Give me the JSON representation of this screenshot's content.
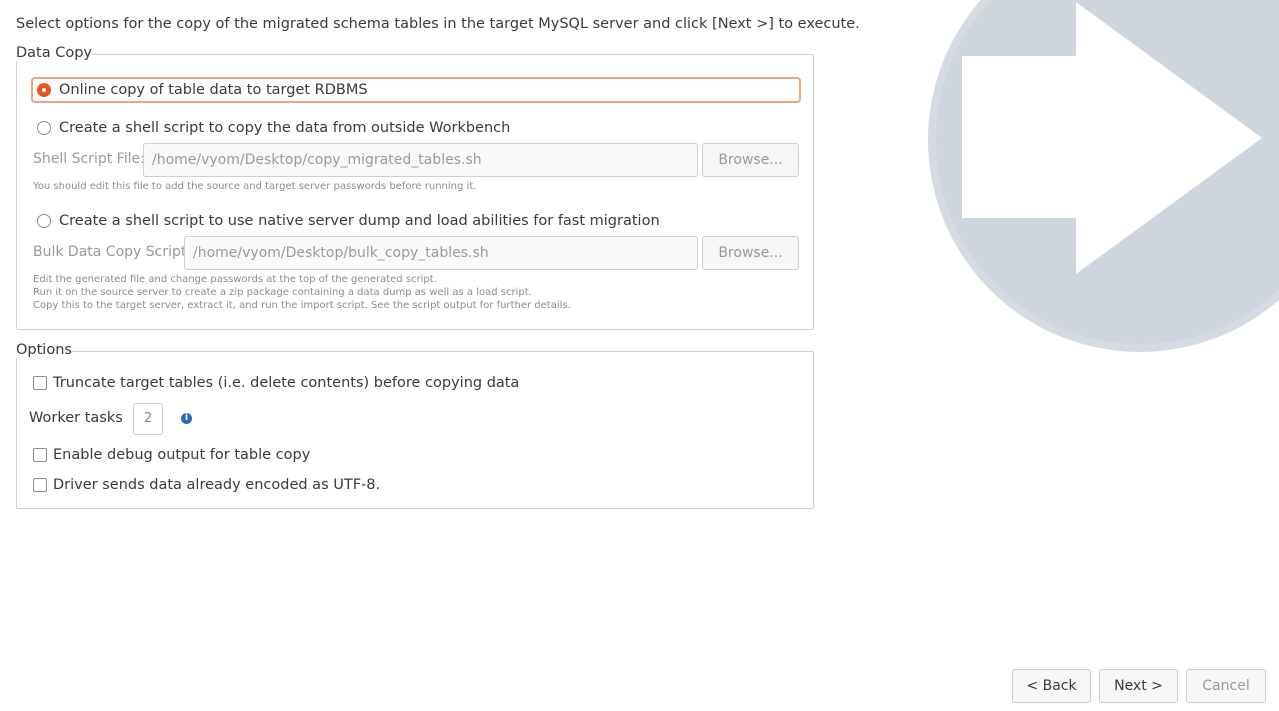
{
  "instruction": "Select options for the copy of the migrated schema tables in the target MySQL server and click [Next >] to execute.",
  "data_copy": {
    "title": "Data Copy",
    "online_copy": {
      "label": "Online copy of table data to target RDBMS",
      "checked": true
    },
    "shell_script": {
      "label": "Create a shell script to copy the data from outside Workbench",
      "checked": false,
      "field_label": "Shell Script File:",
      "field_value": "/home/vyom/Desktop/copy_migrated_tables.sh",
      "browse_label": "Browse...",
      "hint": "You should edit this file to add the source and target server passwords before running it."
    },
    "bulk_script": {
      "label": "Create a shell script to use native server dump and load abilities for fast migration",
      "checked": false,
      "field_label": "Bulk Data Copy Script:",
      "field_value": "/home/vyom/Desktop/bulk_copy_tables.sh",
      "browse_label": "Browse...",
      "hint_lines": [
        "Edit the generated file and change passwords at the top of the generated script.",
        "Run it on the source server to create a zip package containing a data dump as well as a load script.",
        "Copy this to the target server, extract it, and run the import script. See the script output for further details."
      ]
    }
  },
  "options": {
    "title": "Options",
    "truncate": {
      "label": "Truncate target tables (i.e. delete contents) before copying data",
      "checked": false
    },
    "worker_tasks": {
      "label": "Worker tasks",
      "value": "2",
      "icon": "info-icon"
    },
    "debug": {
      "label": "Enable debug output for table copy",
      "checked": false
    },
    "utf8": {
      "label": "Driver sends data already encoded as UTF-8.",
      "checked": false
    }
  },
  "footer": {
    "back_label": "< Back",
    "next_label": "Next >",
    "cancel_label": "Cancel"
  },
  "colors": {
    "accent": "#e95420",
    "graphic": "#d6dbe3"
  }
}
